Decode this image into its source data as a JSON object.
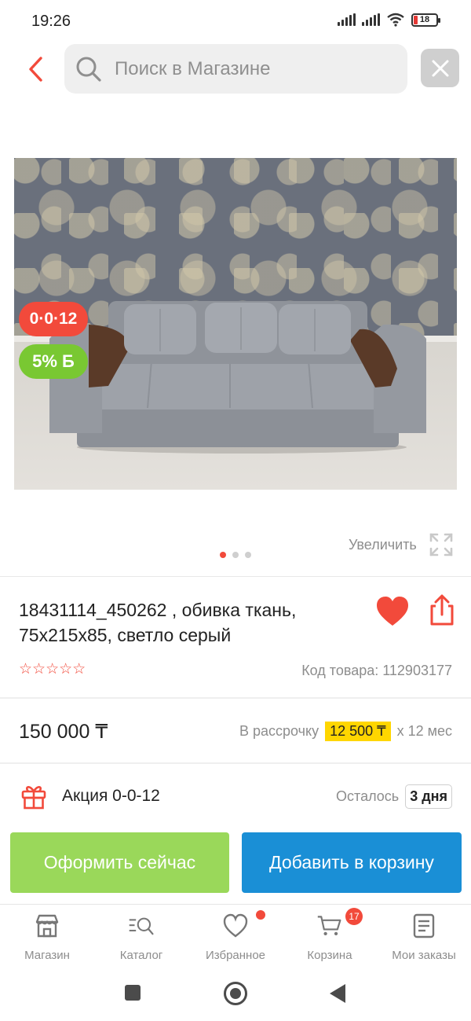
{
  "status_bar": {
    "time": "19:26",
    "battery": "18"
  },
  "header": {
    "search_placeholder": "Поиск в Магазине"
  },
  "gallery": {
    "badge_installment": "0·0·12",
    "badge_bonus": "5% Б",
    "zoom_label": "Увеличить",
    "image_count": 3,
    "active_image": 1
  },
  "product": {
    "title": "18431114_450262 , обивка ткань, 75x215x85, светло серый",
    "rating_stars": "☆☆☆☆☆",
    "code": "Код товара: 112903177",
    "price": "150 000 ₸",
    "installment_prefix": "В рассрочку",
    "installment_amount": "12 500 ₸",
    "installment_suffix": "x 12 мес"
  },
  "promo": {
    "label": "Акция 0-0-12",
    "remaining_label": "Осталось",
    "remaining_value": "3 дня"
  },
  "actions": {
    "checkout_label": "Оформить сейчас",
    "cart_label": "Добавить в корзину"
  },
  "tab_bar": {
    "items": [
      {
        "label": "Магазин",
        "icon": "shop-icon"
      },
      {
        "label": "Каталог",
        "icon": "catalog-icon"
      },
      {
        "label": "Избранное",
        "icon": "heart-icon"
      },
      {
        "label": "Корзина",
        "icon": "cart-icon"
      },
      {
        "label": "Мои заказы",
        "icon": "orders-icon"
      }
    ],
    "cart_count": "17"
  },
  "colors": {
    "accent_red": "#f24a3b",
    "checkout_green": "#9ad85a",
    "cart_blue": "#1a8fd6",
    "installment_yellow": "#ffd600"
  }
}
